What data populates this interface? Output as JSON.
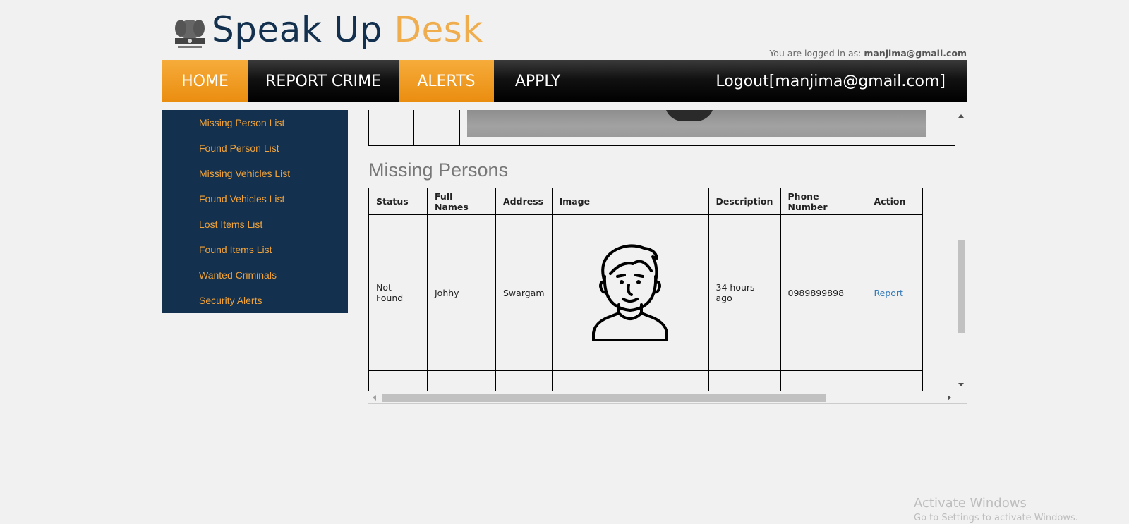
{
  "header": {
    "brand_part1": "Speak Up",
    "brand_part2": "Desk",
    "logged_in_prefix": "You are logged in as:",
    "logged_in_user": "manjima@gmail.com"
  },
  "nav": {
    "home": "HOME",
    "report_crime": "REPORT CRIME",
    "alerts": "ALERTS",
    "apply": "APPLY",
    "logout": "Logout[manjima@gmail.com]"
  },
  "sidebar": {
    "items": [
      {
        "label": "Missing Person List"
      },
      {
        "label": "Found Person List"
      },
      {
        "label": "Missing Vehicles List"
      },
      {
        "label": "Found Vehicles List"
      },
      {
        "label": "Lost Items List"
      },
      {
        "label": "Found Items List"
      },
      {
        "label": "Wanted Criminals"
      },
      {
        "label": "Security Alerts"
      }
    ]
  },
  "content": {
    "section_title": "Missing Persons",
    "columns": [
      "Status",
      "Full Names",
      "Address",
      "Image",
      "Description",
      "Phone Number",
      "Action"
    ],
    "rows": [
      {
        "status": "Not Found",
        "full_name": "Johhy",
        "address": "Swargam",
        "image_icon": "person-avatar-icon",
        "description": "34 hours ago",
        "phone": "0989899898",
        "action": "Report"
      }
    ]
  },
  "watermark": {
    "line1": "Activate Windows",
    "line2": "Go to Settings to activate Windows."
  },
  "colors": {
    "brand_dark": "#13304f",
    "brand_accent": "#f0ad4e",
    "nav_active": "#f0a030",
    "link": "#337ab7"
  }
}
